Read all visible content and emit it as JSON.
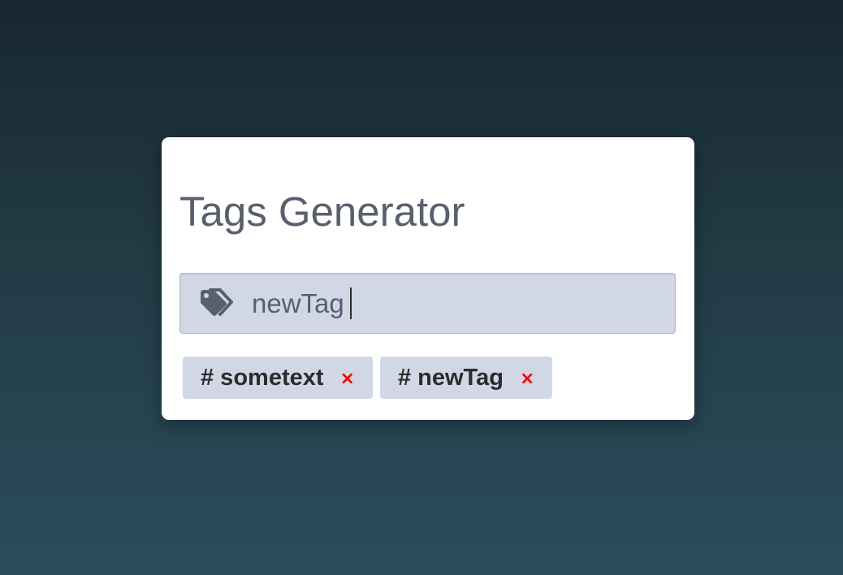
{
  "app": {
    "title": "Tags Generator"
  },
  "input": {
    "icon": "tags-icon",
    "value": "newTag"
  },
  "tags": [
    {
      "label": "# sometext",
      "remove_icon": "close-icon",
      "remove_label": "×"
    },
    {
      "label": "# newTag",
      "remove_icon": "close-icon",
      "remove_label": "×"
    }
  ],
  "colors": {
    "card": "#ffffff",
    "title": "#59606d",
    "input_bg": "#d1d7e5",
    "tag_bg": "#d1d7e5",
    "tag_text": "#2b2b2b",
    "remove": "#f00000",
    "background_top": "#18272f",
    "background_bottom": "#2a4d5c"
  }
}
